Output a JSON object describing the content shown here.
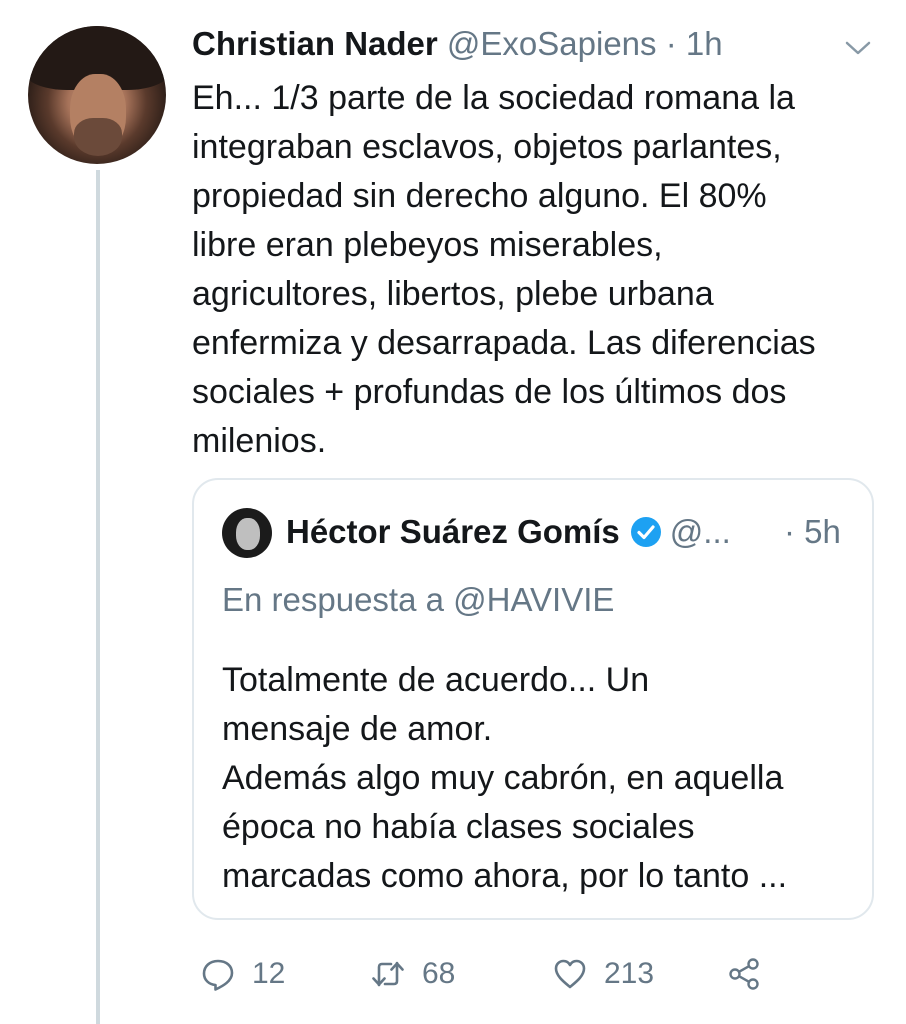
{
  "tweet": {
    "author_name": "Christian Nader",
    "author_handle": "@ExoSapiens",
    "separator": "·",
    "time": "1h",
    "lines": [
      "Eh... 1/3 parte de la sociedad romana la",
      "integraban esclavos, objetos parlantes,",
      "propiedad sin derecho alguno. El 80%",
      "libre eran plebeyos miserables,",
      "agricultores, libertos, plebe urbana",
      "enfermiza y desarrapada. Las diferencias",
      "sociales + profundas de los últimos dos",
      "milenios."
    ]
  },
  "quoted": {
    "author_name": "Héctor Suárez Gomís",
    "author_handle": "@...",
    "time": "· 5h",
    "reply_to": "En respuesta a @HAVIVIE",
    "lines": [
      "Totalmente de acuerdo... Un",
      "mensaje de amor.",
      "Además algo muy cabrón, en aquella",
      "época no había clases sociales",
      "marcadas como ahora, por lo tanto ..."
    ]
  },
  "actions": {
    "replies": "12",
    "retweets": "68",
    "likes": "213"
  },
  "icons": [
    "avatar",
    "chevron-down-icon",
    "verified-badge-icon",
    "reply-icon",
    "retweet-icon",
    "like-icon",
    "share-icon"
  ],
  "colors": {
    "text": "#14171a",
    "muted": "#657786",
    "verified": "#1da1f2",
    "border": "#e1e8ed"
  }
}
